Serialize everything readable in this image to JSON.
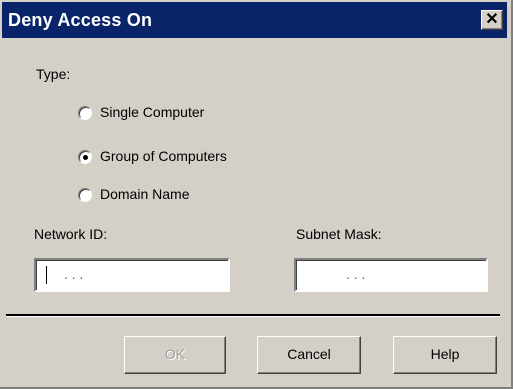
{
  "window": {
    "title": "Deny Access On",
    "close_glyph": "✕"
  },
  "type_group": {
    "label": "Type:",
    "options": [
      {
        "label": "Single Computer",
        "checked": false
      },
      {
        "label": "Group of Computers",
        "checked": true
      },
      {
        "label": "Domain Name",
        "checked": false
      }
    ]
  },
  "network_id": {
    "label": "Network ID:",
    "value": ".   .   ."
  },
  "subnet_mask": {
    "label": "Subnet Mask:",
    "value": ".   .   ."
  },
  "buttons": {
    "ok": "OK",
    "cancel": "Cancel",
    "help": "Help"
  },
  "colors": {
    "titlebar": "#0a246a",
    "face": "#d4d0c8"
  }
}
